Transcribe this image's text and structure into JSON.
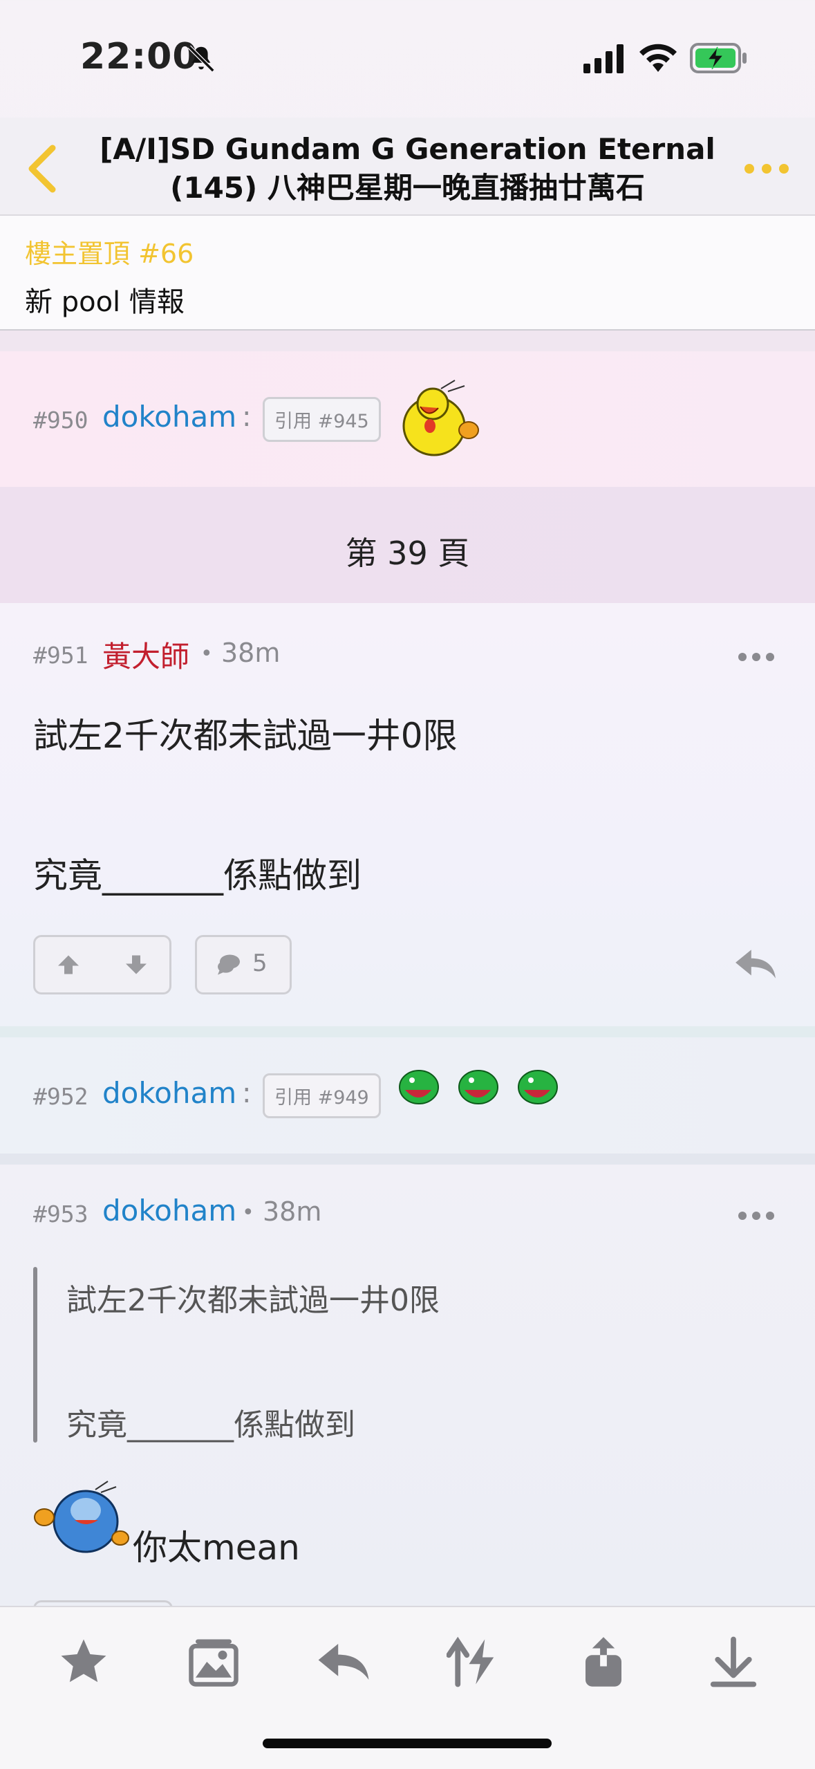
{
  "status_bar": {
    "time": "22:00"
  },
  "header": {
    "title_line1": "[A/I]SD Gundam G Generation Eternal",
    "title_line2": "(145) 八神巴星期一晚直播抽廿萬石"
  },
  "pinned": {
    "label": "樓主置頂 #66",
    "text": "新 pool 情報"
  },
  "posts": {
    "p950": {
      "num": "#950",
      "user": "dokoham",
      "colon": ":",
      "quote": "引用 #945"
    },
    "page_sep": "第 39 頁",
    "p951": {
      "num": "#951",
      "user": "黃大師",
      "dot": "•",
      "age": "38m",
      "line1": "試左2千次都未試過一井0限",
      "line2": "究竟_______係點做到",
      "comments": "5"
    },
    "p952": {
      "num": "#952",
      "user": "dokoham",
      "colon": ":",
      "quote": "引用 #949"
    },
    "p953": {
      "num": "#953",
      "user": "dokoham",
      "dot": "•",
      "age": "38m",
      "quote_line1": "試左2千次都未試過一井0限",
      "quote_line2": "究竟_______係點做到",
      "reply": "你太mean"
    }
  },
  "colors": {
    "accent_yellow": "#f2c431",
    "link_blue": "#2183c9",
    "username_red": "#c21f2e"
  },
  "icons": {
    "toolbar": [
      "star-icon",
      "gallery-icon",
      "reply-icon",
      "sort-icon",
      "share-icon",
      "download-icon"
    ]
  }
}
